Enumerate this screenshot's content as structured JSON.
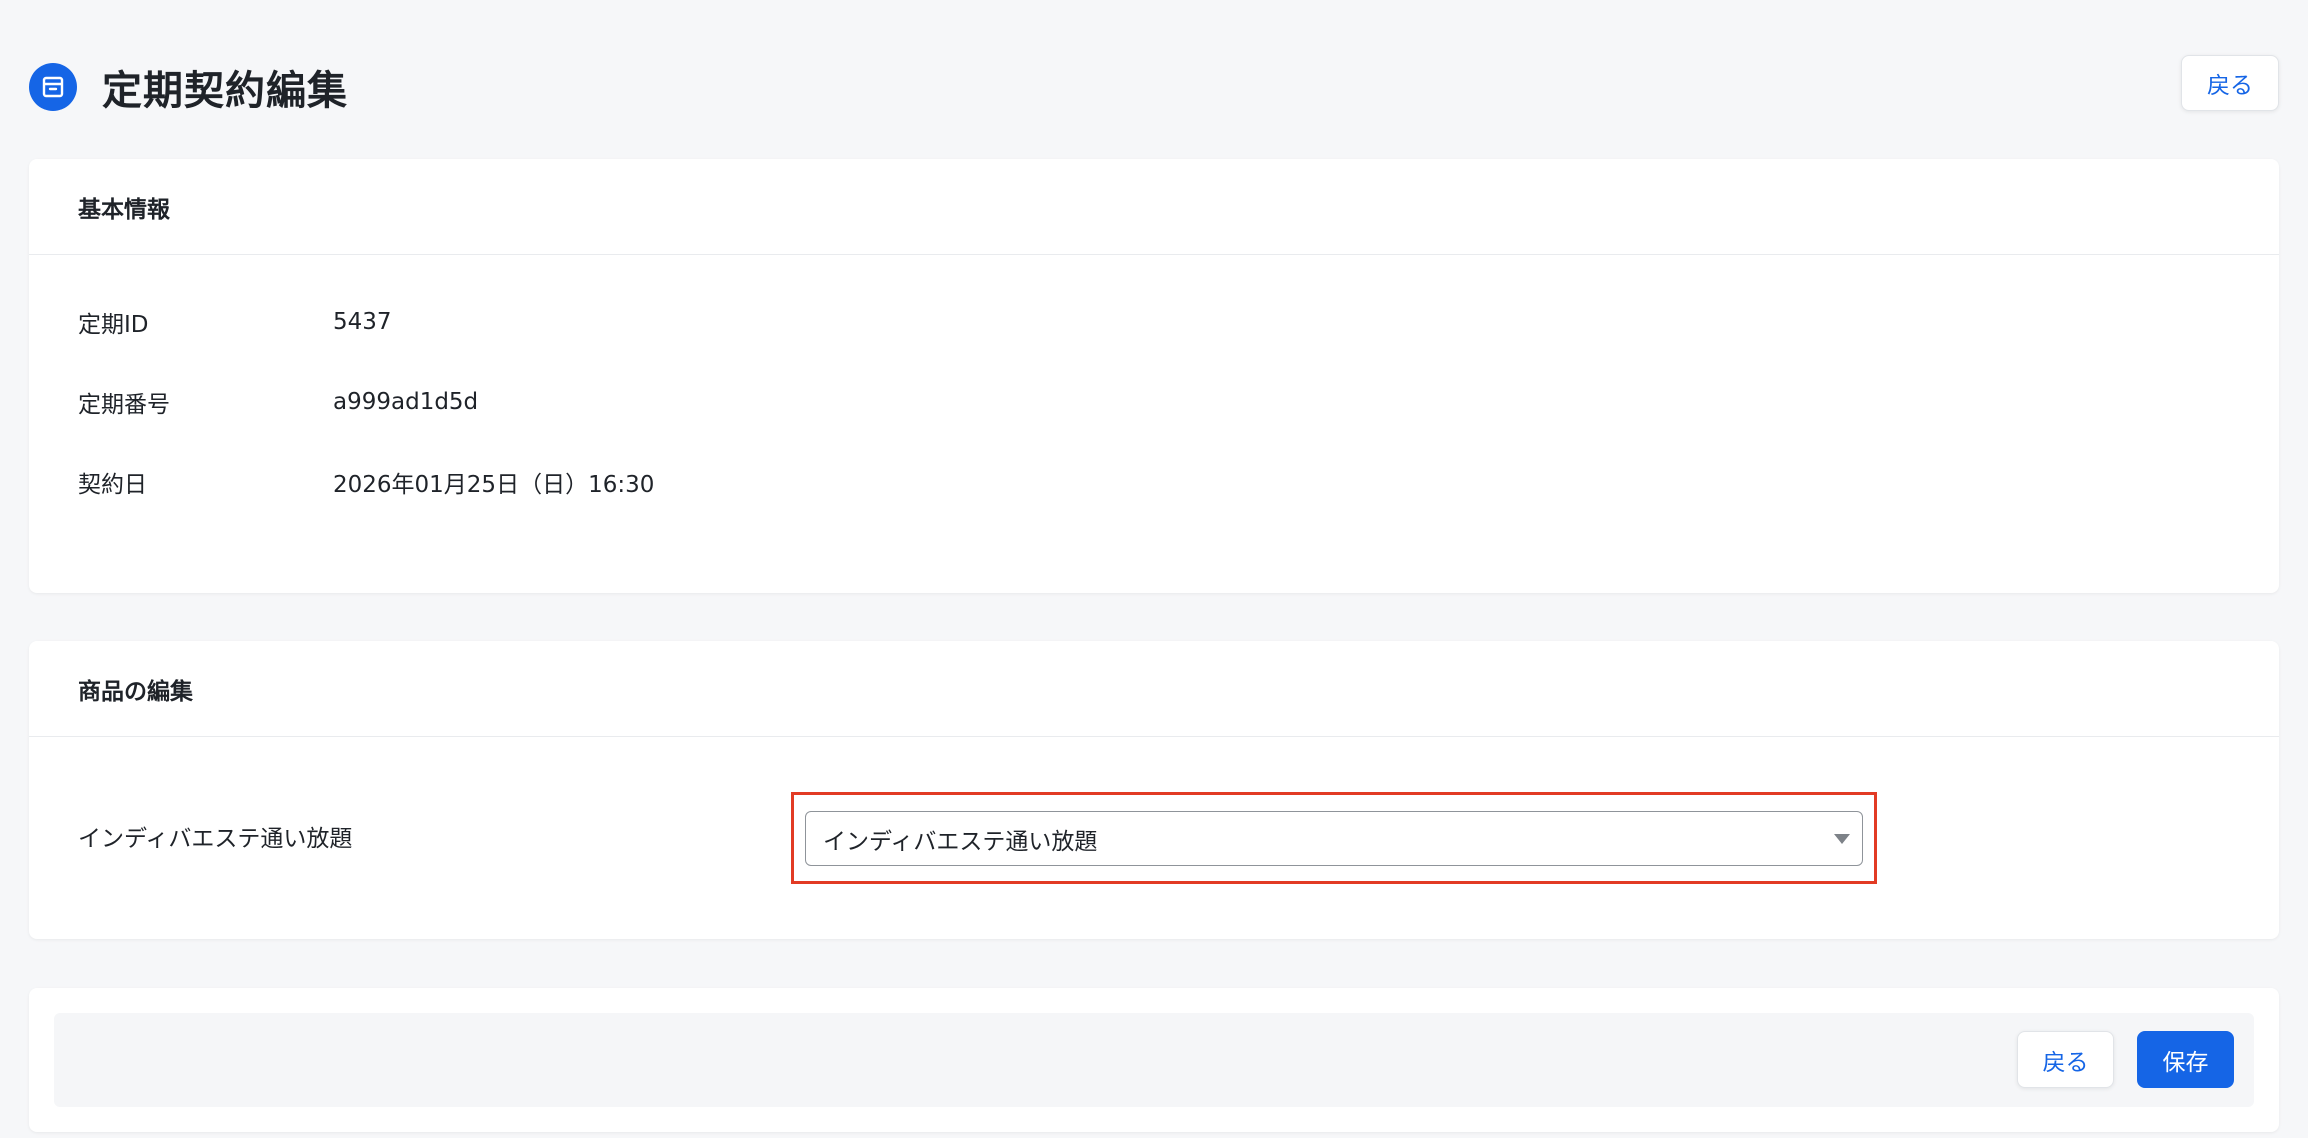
{
  "header": {
    "title": "定期契約編集",
    "back_label": "戻る"
  },
  "basic_info": {
    "section_title": "基本情報",
    "rows": [
      {
        "label": "定期ID",
        "value": "5437"
      },
      {
        "label": "定期番号",
        "value": "a999ad1d5d"
      },
      {
        "label": "契約日",
        "value": "2026年01月25日（日）16:30"
      }
    ]
  },
  "product_edit": {
    "section_title": "商品の編集",
    "product_label": "インディバエステ通い放題",
    "selected_option": "インディバエステ通い放題"
  },
  "footer": {
    "back_label": "戻る",
    "save_label": "保存"
  },
  "colors": {
    "accent": "#1565e6",
    "highlight": "#e23b24",
    "background": "#f6f7f9"
  },
  "icons": {
    "title_icon": "archive-box-icon",
    "select_arrow": "caret-down-icon"
  }
}
